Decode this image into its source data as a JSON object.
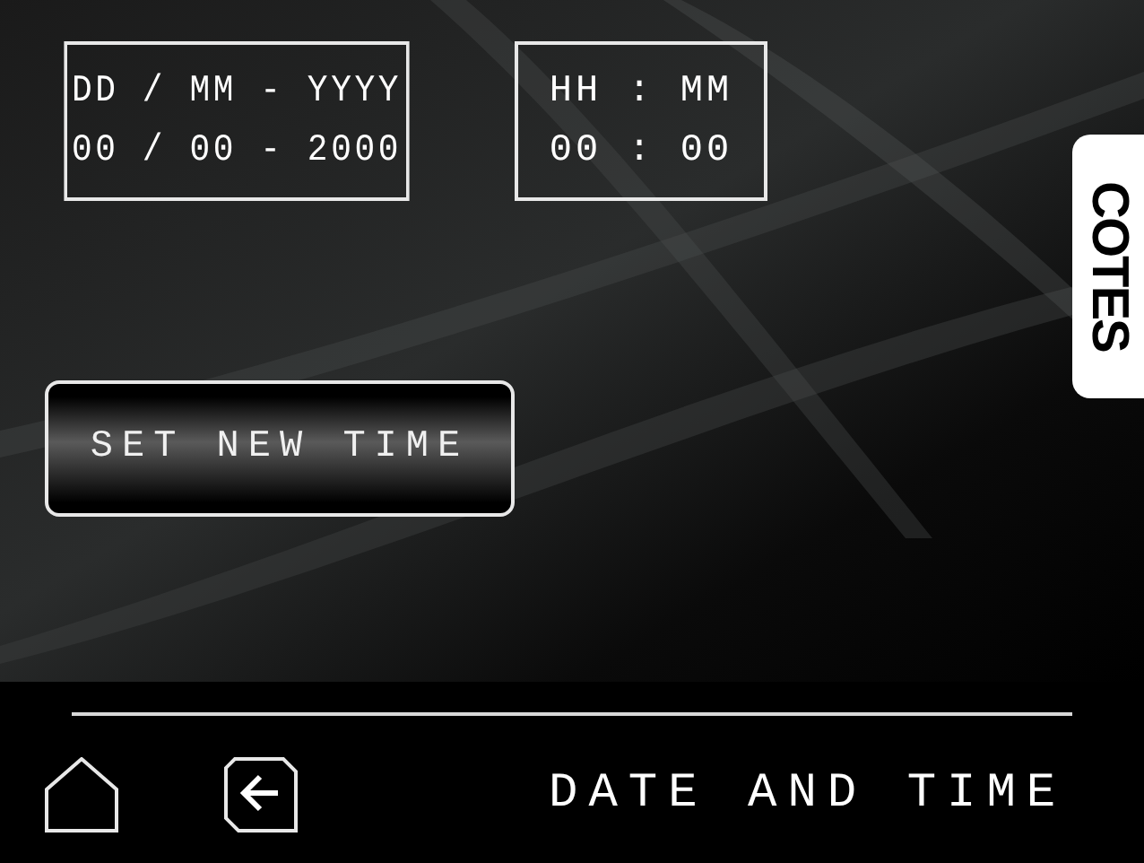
{
  "date_box": {
    "format": "DD / MM - YYYY",
    "value": "00 / 00 - 2000"
  },
  "time_box": {
    "format": "HH : MM",
    "value": "00 : 00"
  },
  "side_tab": {
    "label": "COTES"
  },
  "set_button": {
    "label": "SET NEW TIME"
  },
  "footer": {
    "title": "DATE AND TIME"
  }
}
